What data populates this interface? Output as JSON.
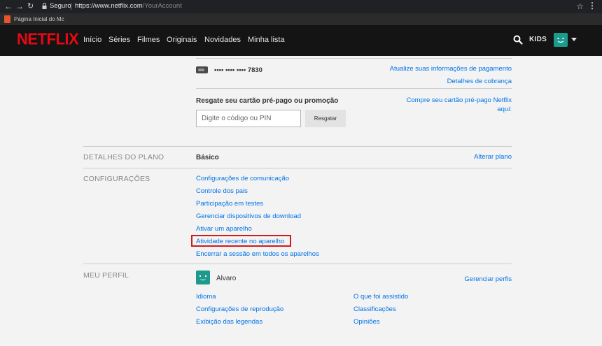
{
  "browser": {
    "security_label": "Seguro",
    "url_host": "https://www.netflix.com",
    "url_path": "/YourAccount",
    "bookmark": "Página Inicial do Mc"
  },
  "header": {
    "logo": "NETFLIX",
    "nav": [
      "Início",
      "Séries",
      "Filmes",
      "Originais",
      "Novidades",
      "Minha lista"
    ],
    "kids": "KIDS",
    "brand_color": "#e50914"
  },
  "payment": {
    "card_number": "•••• •••• •••• 7830",
    "update_link": "Atualize suas informações de pagamento",
    "billing_link": "Detalhes de cobrança"
  },
  "redeem": {
    "title": "Resgate seu cartão pré-pago ou promoção",
    "input_placeholder": "Digite o código ou PIN",
    "button": "Resgatar",
    "buy_link_line1": "Compre seu cartão pré-pago Netflix",
    "buy_link_line2": "aqui:"
  },
  "plan": {
    "label": "DETALHES DO PLANO",
    "value": "Básico",
    "change_link": "Alterar plano"
  },
  "settings": {
    "label": "CONFIGURAÇÕES",
    "links": [
      "Configurações de comunicação",
      "Controle dos pais",
      "Participação em testes",
      "Gerenciar dispositivos de download",
      "Ativar um aparelho",
      "Atividade recente no aparelho",
      "Encerrar a sessão em todos os aparelhos"
    ]
  },
  "profile": {
    "label": "MEU PERFIL",
    "name": "Alvaro",
    "manage_link": "Gerenciar perfis",
    "left_links": [
      "Idioma",
      "Configurações de reprodução",
      "Exibição das legendas"
    ],
    "right_links": [
      "O que foi assistido",
      "Classificações",
      "Opiniões"
    ]
  },
  "colors": {
    "link": "#0073e6",
    "highlight": "#d11a1a",
    "avatar": "#1c9a8d"
  }
}
